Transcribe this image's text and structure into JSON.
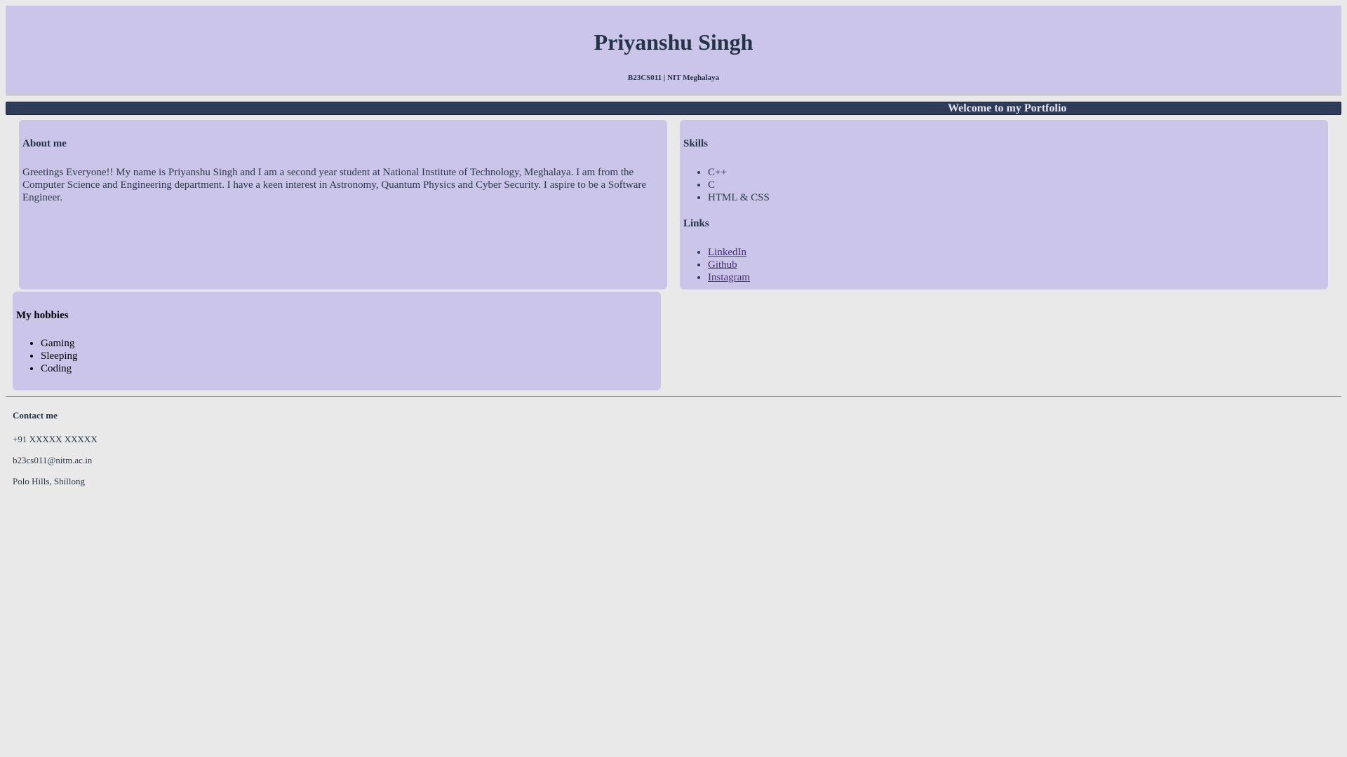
{
  "header": {
    "name": "Priyanshu Singh",
    "subtitle": "B23CS011 | NIT Meghalaya"
  },
  "banner": {
    "text": "Welcome to my Portfolio"
  },
  "about": {
    "heading": "About me",
    "text": "Greetings Everyone!! My name is Priyanshu Singh and I am a second year student at National Institute of Technology, Meghalaya. I am from the Computer Science and Engineering department. I have a keen interest in Astronomy, Quantum Physics and Cyber Security. I aspire to be a Software Engineer."
  },
  "skills": {
    "heading": "Skills",
    "items": [
      "C++",
      "C",
      "HTML & CSS"
    ]
  },
  "links": {
    "heading": "Links",
    "items": [
      "LinkedIn",
      "Github",
      "Instagram"
    ]
  },
  "hobbies": {
    "heading": "My hobbies",
    "items": [
      "Gaming",
      "Sleeping",
      "Coding"
    ]
  },
  "contact": {
    "heading": "Contact me",
    "phone": "+91 XXXXX XXXXX",
    "email": "b23cs011@nitm.ac.in",
    "address": "Polo Hills, Shillong"
  },
  "colors": {
    "page_background": "#e9e9e9",
    "card_background": "#cbc5e9",
    "banner_background": "#2f3c59",
    "link_color": "#4a2a7a"
  }
}
